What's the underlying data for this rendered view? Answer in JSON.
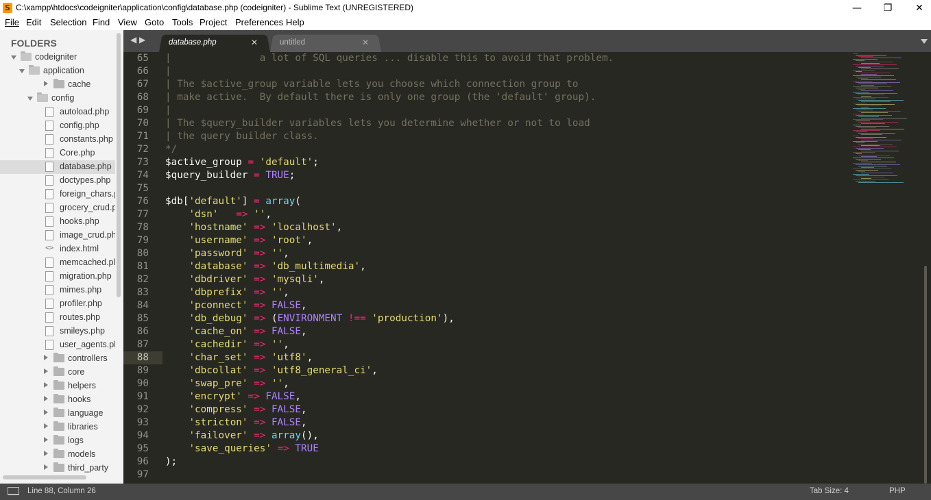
{
  "window": {
    "title": "C:\\xampp\\htdocs\\codeigniter\\application\\config\\database.php (codeigniter) - Sublime Text (UNREGISTERED)",
    "minimize": "—",
    "maximize": "❐",
    "close": "✕"
  },
  "menu": [
    "File",
    "Edit",
    "Selection",
    "Find",
    "View",
    "Goto",
    "Tools",
    "Project",
    "Preferences",
    "Help"
  ],
  "sidebar": {
    "heading": "FOLDERS",
    "tree": [
      {
        "label": "codeigniter",
        "kind": "folder",
        "depth": 0,
        "expanded": true
      },
      {
        "label": "application",
        "kind": "folder",
        "depth": 1,
        "expanded": true
      },
      {
        "label": "cache",
        "kind": "folder",
        "depth": 2,
        "expanded": false
      },
      {
        "label": "config",
        "kind": "folder",
        "depth": 2,
        "expanded": true
      },
      {
        "label": "autoload.php",
        "kind": "file",
        "depth": 3
      },
      {
        "label": "config.php",
        "kind": "file",
        "depth": 3
      },
      {
        "label": "constants.php",
        "kind": "file",
        "depth": 3
      },
      {
        "label": "Core.php",
        "kind": "file",
        "depth": 3
      },
      {
        "label": "database.php",
        "kind": "file",
        "depth": 3,
        "selected": true
      },
      {
        "label": "doctypes.php",
        "kind": "file",
        "depth": 3
      },
      {
        "label": "foreign_chars.p",
        "kind": "file",
        "depth": 3
      },
      {
        "label": "grocery_crud.p",
        "kind": "file",
        "depth": 3
      },
      {
        "label": "hooks.php",
        "kind": "file",
        "depth": 3
      },
      {
        "label": "image_crud.ph",
        "kind": "file",
        "depth": 3
      },
      {
        "label": "index.html",
        "kind": "code",
        "depth": 3
      },
      {
        "label": "memcached.pl",
        "kind": "file",
        "depth": 3
      },
      {
        "label": "migration.php",
        "kind": "file",
        "depth": 3
      },
      {
        "label": "mimes.php",
        "kind": "file",
        "depth": 3
      },
      {
        "label": "profiler.php",
        "kind": "file",
        "depth": 3
      },
      {
        "label": "routes.php",
        "kind": "file",
        "depth": 3
      },
      {
        "label": "smileys.php",
        "kind": "file",
        "depth": 3
      },
      {
        "label": "user_agents.ph",
        "kind": "file",
        "depth": 3
      },
      {
        "label": "controllers",
        "kind": "folder",
        "depth": 2,
        "expanded": false
      },
      {
        "label": "core",
        "kind": "folder",
        "depth": 2,
        "expanded": false
      },
      {
        "label": "helpers",
        "kind": "folder",
        "depth": 2,
        "expanded": false
      },
      {
        "label": "hooks",
        "kind": "folder",
        "depth": 2,
        "expanded": false
      },
      {
        "label": "language",
        "kind": "folder",
        "depth": 2,
        "expanded": false
      },
      {
        "label": "libraries",
        "kind": "folder",
        "depth": 2,
        "expanded": false
      },
      {
        "label": "logs",
        "kind": "folder",
        "depth": 2,
        "expanded": false
      },
      {
        "label": "models",
        "kind": "folder",
        "depth": 2,
        "expanded": false
      },
      {
        "label": "third_party",
        "kind": "folder",
        "depth": 2,
        "expanded": false
      }
    ]
  },
  "tabs": {
    "nav": "◀ ▶",
    "items": [
      {
        "label": "database.php",
        "close": "✕",
        "active": true
      },
      {
        "label": "untitled",
        "close": "✕",
        "active": false
      }
    ]
  },
  "editor": {
    "current_line": 88,
    "lines": [
      {
        "n": "65",
        "tokens": [
          [
            "c-com",
            "|               a lot of SQL queries ... disable this to avoid that problem."
          ]
        ]
      },
      {
        "n": "66",
        "tokens": [
          [
            "c-com",
            "|"
          ]
        ]
      },
      {
        "n": "67",
        "tokens": [
          [
            "c-com",
            "| The $active_group variable lets you choose which connection group to"
          ]
        ]
      },
      {
        "n": "68",
        "tokens": [
          [
            "c-com",
            "| make active.  By default there is only one group (the 'default' group)."
          ]
        ]
      },
      {
        "n": "69",
        "tokens": [
          [
            "c-com",
            "|"
          ]
        ]
      },
      {
        "n": "70",
        "tokens": [
          [
            "c-com",
            "| The $query_builder variables lets you determine whether or not to load"
          ]
        ]
      },
      {
        "n": "71",
        "tokens": [
          [
            "c-com",
            "| the query builder class."
          ]
        ]
      },
      {
        "n": "72",
        "tokens": [
          [
            "c-com",
            "*/"
          ]
        ]
      },
      {
        "n": "73",
        "tokens": [
          [
            "c-plain",
            "$active_group "
          ],
          [
            "c-op",
            "="
          ],
          [
            "c-plain",
            " "
          ],
          [
            "c-str",
            "'default'"
          ],
          [
            "c-plain",
            ";"
          ]
        ]
      },
      {
        "n": "74",
        "tokens": [
          [
            "c-plain",
            "$query_builder "
          ],
          [
            "c-op",
            "="
          ],
          [
            "c-plain",
            " "
          ],
          [
            "c-kw",
            "TRUE"
          ],
          [
            "c-plain",
            ";"
          ]
        ]
      },
      {
        "n": "75",
        "tokens": []
      },
      {
        "n": "76",
        "tokens": [
          [
            "c-plain",
            "$db["
          ],
          [
            "c-str",
            "'default'"
          ],
          [
            "c-plain",
            "] "
          ],
          [
            "c-op",
            "="
          ],
          [
            "c-plain",
            " "
          ],
          [
            "c-fn",
            "array"
          ],
          [
            "c-plain",
            "("
          ]
        ]
      },
      {
        "n": "77",
        "tokens": [
          [
            "c-plain",
            "    "
          ],
          [
            "c-str",
            "'dsn'"
          ],
          [
            "c-plain",
            "   "
          ],
          [
            "c-op",
            "=>"
          ],
          [
            "c-plain",
            " "
          ],
          [
            "c-str",
            "''"
          ],
          [
            "c-plain",
            ","
          ]
        ]
      },
      {
        "n": "78",
        "tokens": [
          [
            "c-plain",
            "    "
          ],
          [
            "c-str",
            "'hostname'"
          ],
          [
            "c-plain",
            " "
          ],
          [
            "c-op",
            "=>"
          ],
          [
            "c-plain",
            " "
          ],
          [
            "c-str",
            "'localhost'"
          ],
          [
            "c-plain",
            ","
          ]
        ]
      },
      {
        "n": "79",
        "tokens": [
          [
            "c-plain",
            "    "
          ],
          [
            "c-str",
            "'username'"
          ],
          [
            "c-plain",
            " "
          ],
          [
            "c-op",
            "=>"
          ],
          [
            "c-plain",
            " "
          ],
          [
            "c-str",
            "'root'"
          ],
          [
            "c-plain",
            ","
          ]
        ]
      },
      {
        "n": "80",
        "tokens": [
          [
            "c-plain",
            "    "
          ],
          [
            "c-str",
            "'password'"
          ],
          [
            "c-plain",
            " "
          ],
          [
            "c-op",
            "=>"
          ],
          [
            "c-plain",
            " "
          ],
          [
            "c-str",
            "''"
          ],
          [
            "c-plain",
            ","
          ]
        ]
      },
      {
        "n": "81",
        "tokens": [
          [
            "c-plain",
            "    "
          ],
          [
            "c-str",
            "'database'"
          ],
          [
            "c-plain",
            " "
          ],
          [
            "c-op",
            "=>"
          ],
          [
            "c-plain",
            " "
          ],
          [
            "c-str",
            "'db_multimedia'"
          ],
          [
            "c-plain",
            ","
          ]
        ]
      },
      {
        "n": "82",
        "tokens": [
          [
            "c-plain",
            "    "
          ],
          [
            "c-str",
            "'dbdriver'"
          ],
          [
            "c-plain",
            " "
          ],
          [
            "c-op",
            "=>"
          ],
          [
            "c-plain",
            " "
          ],
          [
            "c-str",
            "'mysqli'"
          ],
          [
            "c-plain",
            ","
          ]
        ]
      },
      {
        "n": "83",
        "tokens": [
          [
            "c-plain",
            "    "
          ],
          [
            "c-str",
            "'dbprefix'"
          ],
          [
            "c-plain",
            " "
          ],
          [
            "c-op",
            "=>"
          ],
          [
            "c-plain",
            " "
          ],
          [
            "c-str",
            "''"
          ],
          [
            "c-plain",
            ","
          ]
        ]
      },
      {
        "n": "84",
        "tokens": [
          [
            "c-plain",
            "    "
          ],
          [
            "c-str",
            "'pconnect'"
          ],
          [
            "c-plain",
            " "
          ],
          [
            "c-op",
            "=>"
          ],
          [
            "c-plain",
            " "
          ],
          [
            "c-kw",
            "FALSE"
          ],
          [
            "c-plain",
            ","
          ]
        ]
      },
      {
        "n": "85",
        "tokens": [
          [
            "c-plain",
            "    "
          ],
          [
            "c-str",
            "'db_debug'"
          ],
          [
            "c-plain",
            " "
          ],
          [
            "c-op",
            "=>"
          ],
          [
            "c-plain",
            " ("
          ],
          [
            "c-kw",
            "ENVIRONMENT"
          ],
          [
            "c-plain",
            " "
          ],
          [
            "c-op",
            "!=="
          ],
          [
            "c-plain",
            " "
          ],
          [
            "c-str",
            "'production'"
          ],
          [
            "c-plain",
            "),"
          ]
        ]
      },
      {
        "n": "86",
        "tokens": [
          [
            "c-plain",
            "    "
          ],
          [
            "c-str",
            "'cache_on'"
          ],
          [
            "c-plain",
            " "
          ],
          [
            "c-op",
            "=>"
          ],
          [
            "c-plain",
            " "
          ],
          [
            "c-kw",
            "FALSE"
          ],
          [
            "c-plain",
            ","
          ]
        ]
      },
      {
        "n": "87",
        "tokens": [
          [
            "c-plain",
            "    "
          ],
          [
            "c-str",
            "'cachedir'"
          ],
          [
            "c-plain",
            " "
          ],
          [
            "c-op",
            "=>"
          ],
          [
            "c-plain",
            " "
          ],
          [
            "c-str",
            "''"
          ],
          [
            "c-plain",
            ","
          ]
        ]
      },
      {
        "n": "88",
        "tokens": [
          [
            "c-plain",
            "    "
          ],
          [
            "c-str",
            "'char_set'"
          ],
          [
            "c-plain",
            " "
          ],
          [
            "c-op",
            "=>"
          ],
          [
            "c-plain",
            " "
          ],
          [
            "c-str",
            "'utf8'"
          ],
          [
            "c-plain",
            ","
          ]
        ]
      },
      {
        "n": "89",
        "tokens": [
          [
            "c-plain",
            "    "
          ],
          [
            "c-str",
            "'dbcollat'"
          ],
          [
            "c-plain",
            " "
          ],
          [
            "c-op",
            "=>"
          ],
          [
            "c-plain",
            " "
          ],
          [
            "c-str",
            "'utf8_general_ci'"
          ],
          [
            "c-plain",
            ","
          ]
        ]
      },
      {
        "n": "90",
        "tokens": [
          [
            "c-plain",
            "    "
          ],
          [
            "c-str",
            "'swap_pre'"
          ],
          [
            "c-plain",
            " "
          ],
          [
            "c-op",
            "=>"
          ],
          [
            "c-plain",
            " "
          ],
          [
            "c-str",
            "''"
          ],
          [
            "c-plain",
            ","
          ]
        ]
      },
      {
        "n": "91",
        "tokens": [
          [
            "c-plain",
            "    "
          ],
          [
            "c-str",
            "'encrypt'"
          ],
          [
            "c-plain",
            " "
          ],
          [
            "c-op",
            "=>"
          ],
          [
            "c-plain",
            " "
          ],
          [
            "c-kw",
            "FALSE"
          ],
          [
            "c-plain",
            ","
          ]
        ]
      },
      {
        "n": "92",
        "tokens": [
          [
            "c-plain",
            "    "
          ],
          [
            "c-str",
            "'compress'"
          ],
          [
            "c-plain",
            " "
          ],
          [
            "c-op",
            "=>"
          ],
          [
            "c-plain",
            " "
          ],
          [
            "c-kw",
            "FALSE"
          ],
          [
            "c-plain",
            ","
          ]
        ]
      },
      {
        "n": "93",
        "tokens": [
          [
            "c-plain",
            "    "
          ],
          [
            "c-str",
            "'stricton'"
          ],
          [
            "c-plain",
            " "
          ],
          [
            "c-op",
            "=>"
          ],
          [
            "c-plain",
            " "
          ],
          [
            "c-kw",
            "FALSE"
          ],
          [
            "c-plain",
            ","
          ]
        ]
      },
      {
        "n": "94",
        "tokens": [
          [
            "c-plain",
            "    "
          ],
          [
            "c-str",
            "'failover'"
          ],
          [
            "c-plain",
            " "
          ],
          [
            "c-op",
            "=>"
          ],
          [
            "c-plain",
            " "
          ],
          [
            "c-fn",
            "array"
          ],
          [
            "c-plain",
            "(),"
          ]
        ]
      },
      {
        "n": "95",
        "tokens": [
          [
            "c-plain",
            "    "
          ],
          [
            "c-str",
            "'save_queries'"
          ],
          [
            "c-plain",
            " "
          ],
          [
            "c-op",
            "=>"
          ],
          [
            "c-plain",
            " "
          ],
          [
            "c-kw",
            "TRUE"
          ]
        ]
      },
      {
        "n": "96",
        "tokens": [
          [
            "c-plain",
            ");"
          ]
        ]
      },
      {
        "n": "97",
        "tokens": []
      }
    ]
  },
  "status": {
    "position": "Line 88, Column 26",
    "tab_size": "Tab Size: 4",
    "syntax": "PHP"
  },
  "colors": {
    "editor_bg": "#272822",
    "comment": "#75715e",
    "string": "#e6db74",
    "operator": "#f92672",
    "constant": "#ae81ff",
    "function": "#66d9ef"
  },
  "icons": {
    "app": "sublime-text-icon",
    "console": "console-panel-icon"
  }
}
